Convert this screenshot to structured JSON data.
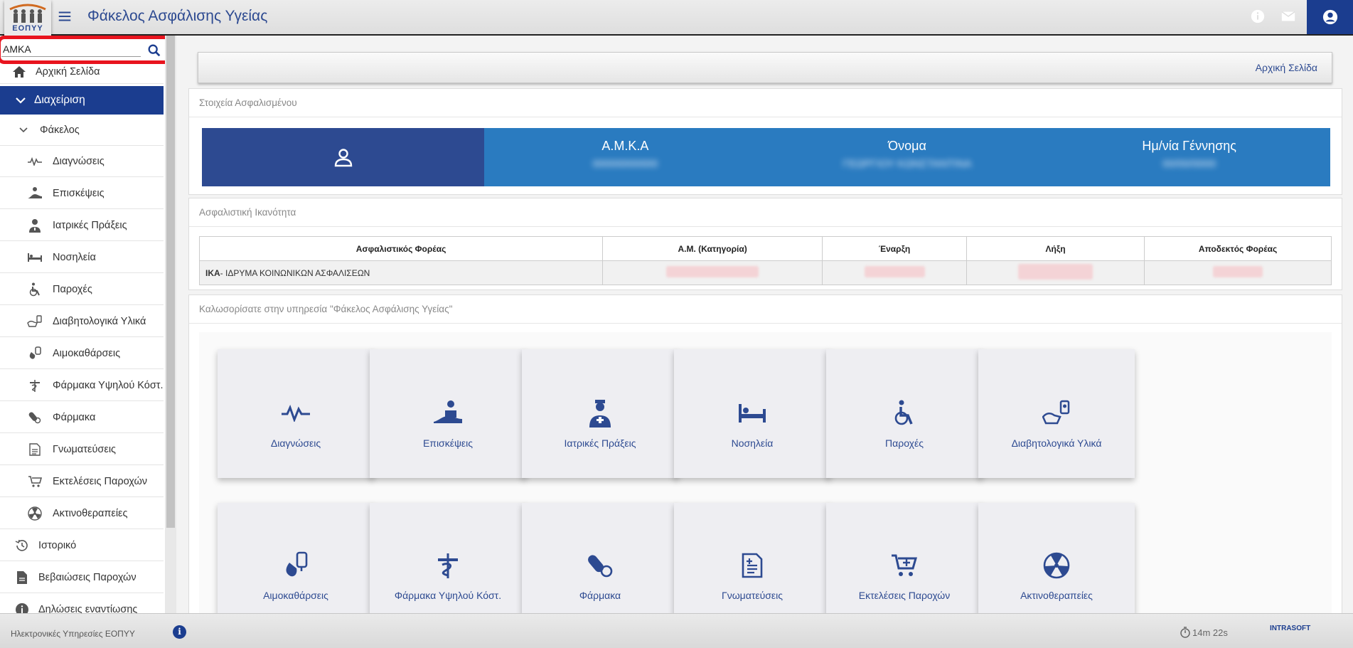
{
  "header": {
    "logo_text": "ΕΟΠΥΥ",
    "title": "Φάκελος Ασφάλισης Υγείας",
    "icons": [
      "menu-icon",
      "info-icon",
      "mail-icon",
      "account-icon"
    ]
  },
  "sidebar": {
    "search": {
      "value": "ΑΜΚΑ",
      "placeholder": "ΑΜΚΑ"
    },
    "home": "Αρχική Σελίδα",
    "management": "Διαχείριση",
    "folder": "Φάκελος",
    "items": [
      "Διαγνώσεις",
      "Επισκέψεις",
      "Ιατρικές Πράξεις",
      "Νοσηλεία",
      "Παροχές",
      "Διαβητολογικά Υλικά",
      "Αιμοκαθάρσεις",
      "Φάρμακα Υψηλού Κόστ.",
      "Φάρμακα",
      "Γνωματεύσεις",
      "Εκτελέσεις Παροχών",
      "Ακτινοθεραπείες"
    ],
    "history": "Ιστορικό",
    "certs": "Βεβαιώσεις Παροχών",
    "declarations": "Δηλώσεις εναντίωσης"
  },
  "breadcrumb": "Αρχική Σελίδα",
  "insured": {
    "heading": "Στοιχεία Ασφαλισμένου",
    "amka_label": "Α.Μ.Κ.Α",
    "amka_value": "00000000000",
    "name_label": "Όνομα",
    "name_value": "ΓΕΩΡΓΙΟΥ ΚΩΝΣΤΑΝΤΙΝΑ",
    "dob_label": "Ημ/νία Γέννησης",
    "dob_value": "00/00/0000"
  },
  "eligibility": {
    "heading": "Ασφαλιστική Ικανότητα",
    "columns": [
      "Ασφαλιστικός Φορέας",
      "Α.Μ. (Κατηγορία)",
      "Έναρξη",
      "Λήξη",
      "Αποδεκτός Φορέας"
    ],
    "row": {
      "fund_code": "ΙΚΑ",
      "fund_name": "- ΙΔΡΥΜΑ ΚΟΙΝΩΝΙΚΩΝ ΑΣΦΑΛΙΣΕΩΝ"
    }
  },
  "welcome": {
    "heading": "Καλωσορίσατε στην υπηρεσία \"Φάκελος Ασφάλισης Υγείας\"",
    "tiles": [
      "Διαγνώσεις",
      "Επισκέψεις",
      "Ιατρικές Πράξεις",
      "Νοσηλεία",
      "Παροχές",
      "Διαβητολογικά Υλικά",
      "Αιμοκαθάρσεις",
      "Φάρμακα Υψηλού Κόστ.",
      "Φάρμακα",
      "Γνωματεύσεις",
      "Εκτελέσεις Παροχών",
      "Ακτινοθεραπείες"
    ]
  },
  "footer": {
    "text": "Ηλεκτρονικές Υπηρεσίες ΕΟΠΥΥ",
    "timer": "14m 22s",
    "brand": "INTRASOFT"
  },
  "colors": {
    "primary": "#1b3d8f",
    "accent": "#2a7bc0",
    "highlight": "#e8141e"
  }
}
